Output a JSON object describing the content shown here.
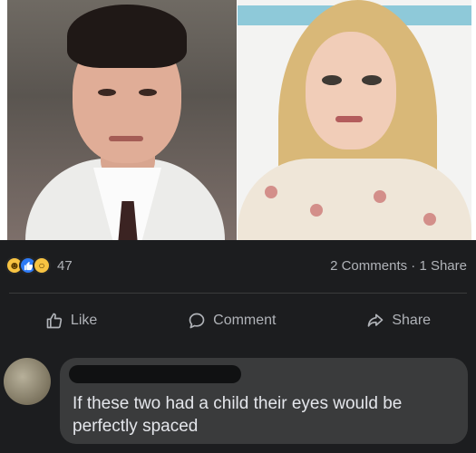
{
  "post": {
    "photos": [
      {
        "subject": "man in white suit"
      },
      {
        "subject": "woman with long blonde hair"
      }
    ]
  },
  "reactions": {
    "icons": [
      "haha-icon",
      "like-icon",
      "wow-icon"
    ],
    "count": "47"
  },
  "engagement": {
    "counts_text": "2 Comments · 1 Share"
  },
  "actions": {
    "like_label": "Like",
    "comment_label": "Comment",
    "share_label": "Share"
  },
  "comment": {
    "author_redacted": true,
    "text": "If these two had a child their eyes would be perfectly spaced"
  },
  "colors": {
    "background": "#1c1d1f",
    "bubble": "#3a3b3c",
    "text": "#e4e6eb",
    "muted": "#b0b3b8",
    "like_blue": "#2e7bf6",
    "emoji_yellow": "#f7c342"
  }
}
